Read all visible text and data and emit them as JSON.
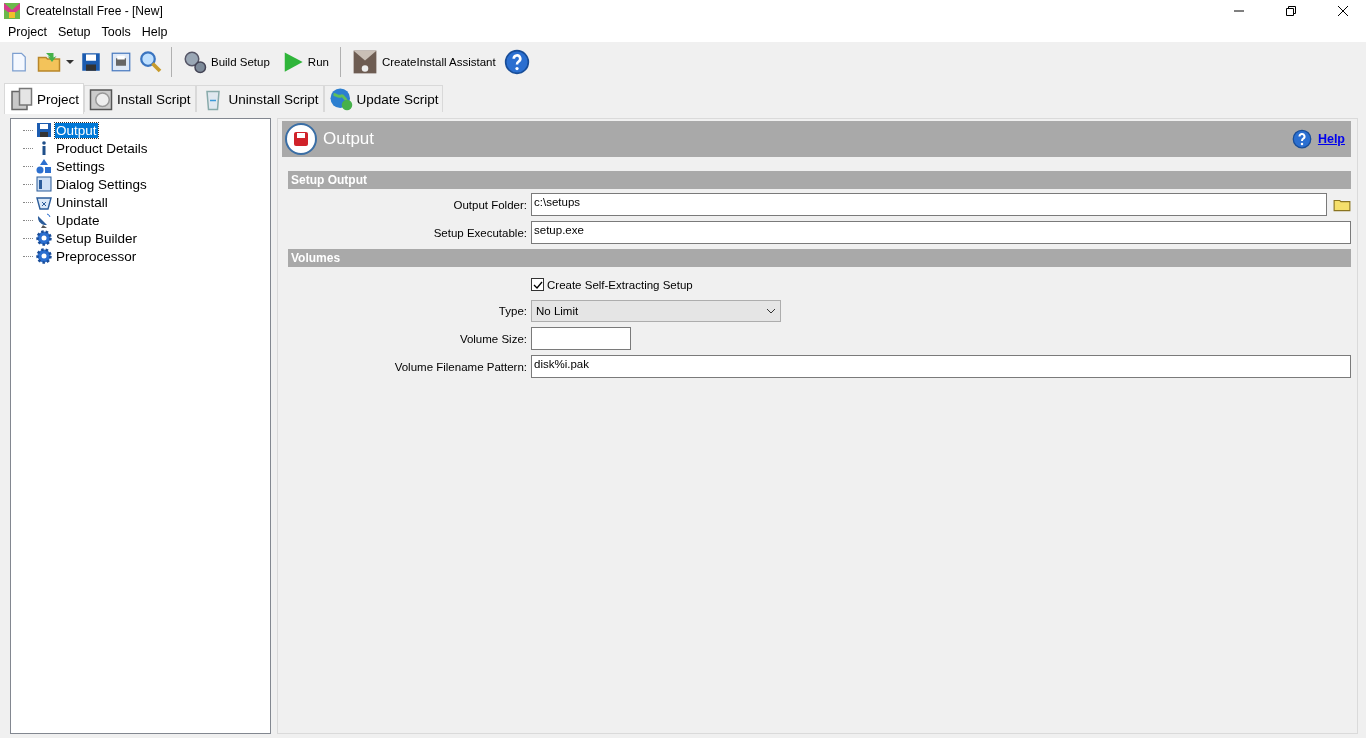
{
  "window": {
    "title": "CreateInstall Free - [New]"
  },
  "menu": [
    "Project",
    "Setup",
    "Tools",
    "Help"
  ],
  "toolbar": [
    {
      "kind": "icon"
    },
    {
      "kind": "icon"
    },
    {
      "kind": "icon"
    },
    {
      "kind": "icon"
    },
    {
      "kind": "icon"
    },
    {
      "kind": "icon"
    },
    {
      "kind": "separator"
    },
    {
      "kind": "button",
      "label": "Build Setup"
    },
    {
      "kind": "button",
      "label": "Run"
    },
    {
      "kind": "separator"
    },
    {
      "kind": "button",
      "label": "CreateInstall Assistant"
    },
    {
      "kind": "icon"
    }
  ],
  "tabs": [
    {
      "label": "Project",
      "selected": true
    },
    {
      "label": "Install Script",
      "selected": false
    },
    {
      "label": "Uninstall Script",
      "selected": false
    },
    {
      "label": "Update Script",
      "selected": false
    }
  ],
  "tree": [
    {
      "label": "Output",
      "selected": true
    },
    {
      "label": "Product Details",
      "selected": false
    },
    {
      "label": "Settings",
      "selected": false
    },
    {
      "label": "Dialog Settings",
      "selected": false
    },
    {
      "label": "Uninstall",
      "selected": false
    },
    {
      "label": "Update",
      "selected": false
    },
    {
      "label": "Setup Builder",
      "selected": false
    },
    {
      "label": "Preprocessor",
      "selected": false
    }
  ],
  "panel": {
    "title": "Output",
    "help": "Help",
    "sections": [
      {
        "title": "Setup Output",
        "rows": [
          {
            "kind": "text",
            "label": "Output Folder:",
            "value": "c:\\setups",
            "browse": true
          },
          {
            "kind": "text",
            "label": "Setup Executable:",
            "value": "setup.exe",
            "browse": false
          }
        ]
      },
      {
        "title": "Volumes",
        "rows": [
          {
            "kind": "checkbox",
            "label": "Create Self-Extracting Setup",
            "checked": true
          },
          {
            "kind": "select",
            "label": "Type:",
            "value": "No Limit"
          },
          {
            "kind": "short",
            "label": "Volume Size:",
            "value": ""
          },
          {
            "kind": "text",
            "label": "Volume Filename Pattern:",
            "value": "disk%i.pak",
            "browse": false
          }
        ]
      }
    ]
  }
}
